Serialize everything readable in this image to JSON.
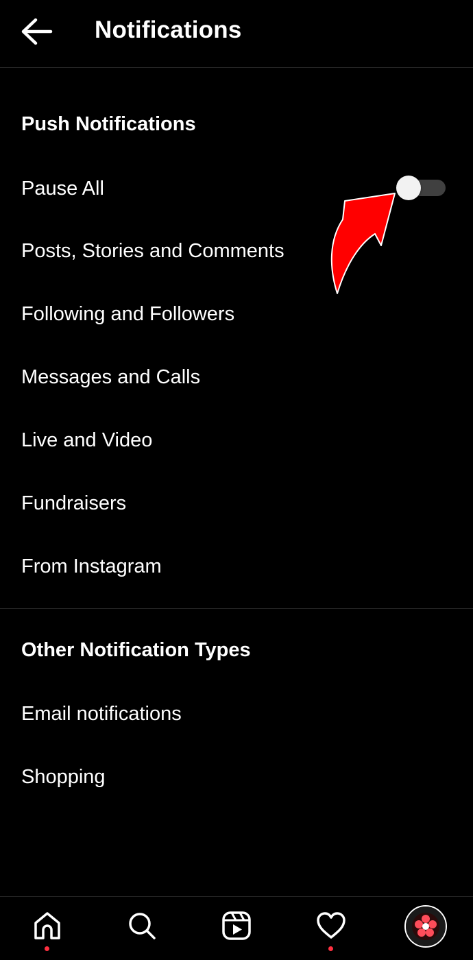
{
  "header": {
    "title": "Notifications",
    "back_icon": "arrow-left-icon"
  },
  "push_section": {
    "title": "Push Notifications",
    "pause_all": {
      "label": "Pause All",
      "enabled": false
    },
    "items": [
      {
        "label": "Posts, Stories and Comments"
      },
      {
        "label": "Following and Followers"
      },
      {
        "label": "Messages and Calls"
      },
      {
        "label": "Live and Video"
      },
      {
        "label": "Fundraisers"
      },
      {
        "label": "From Instagram"
      }
    ]
  },
  "other_section": {
    "title": "Other Notification Types",
    "items": [
      {
        "label": "Email notifications"
      },
      {
        "label": "Shopping"
      }
    ]
  },
  "annotation": {
    "color": "#ff0000",
    "icon": "red-pointer-arrow"
  },
  "bottom_nav": {
    "items": [
      {
        "icon": "home-icon",
        "has_dot": true
      },
      {
        "icon": "search-icon",
        "has_dot": false
      },
      {
        "icon": "reels-icon",
        "has_dot": false
      },
      {
        "icon": "heart-icon",
        "has_dot": true
      },
      {
        "icon": "profile-avatar",
        "has_dot": false
      }
    ],
    "dot_color": "#ff3040"
  }
}
